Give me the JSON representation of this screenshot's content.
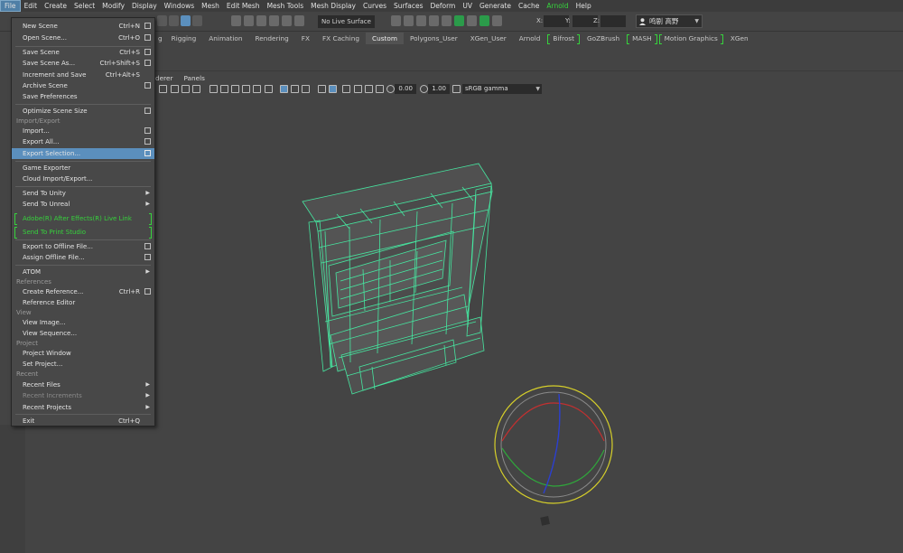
{
  "menubar": {
    "items": [
      "File",
      "Edit",
      "Create",
      "Select",
      "Modify",
      "Display",
      "Windows",
      "Mesh",
      "Edit Mesh",
      "Mesh Tools",
      "Mesh Display",
      "Curves",
      "Surfaces",
      "Deform",
      "UV",
      "Generate",
      "Cache",
      "Arnold",
      "Help"
    ]
  },
  "statusline": {
    "live_surface": "No Live Surface",
    "coord_x_label": "X:",
    "coord_y_label": "Y:",
    "coord_z_label": "Z:",
    "user_name": "鸣剧 高野"
  },
  "shelf": {
    "tabs": [
      "g",
      "Rigging",
      "Animation",
      "Rendering",
      "FX",
      "FX Caching",
      "Custom",
      "Polygons_User",
      "XGen_User",
      "Arnold",
      "Bifrost",
      "GoZBrush",
      "MASH",
      "Motion Graphics",
      "XGen"
    ],
    "selected": "Custom"
  },
  "panel_menu": {
    "items": [
      "derer",
      "Panels"
    ]
  },
  "view_toolbar": {
    "exposure": "0.00",
    "gamma": "1.00",
    "colorspace": "sRGB gamma"
  },
  "file_menu": {
    "items": [
      {
        "label": "New Scene",
        "shortcut": "Ctrl+N",
        "box": true
      },
      {
        "label": "Open Scene...",
        "shortcut": "Ctrl+O",
        "box": true
      },
      {
        "label": "Save Scene",
        "shortcut": "Ctrl+S",
        "box": true
      },
      {
        "label": "Save Scene As...",
        "shortcut": "Ctrl+Shift+S",
        "box": true
      },
      {
        "label": "Increment and Save",
        "shortcut": "Ctrl+Alt+S",
        "box": false
      },
      {
        "label": "Archive Scene",
        "shortcut": "",
        "box": true
      },
      {
        "label": "Save Preferences",
        "shortcut": "",
        "box": false
      },
      {
        "label": "Optimize Scene Size",
        "shortcut": "",
        "box": true
      },
      {
        "section": "Import/Export"
      },
      {
        "label": "Import...",
        "shortcut": "",
        "box": true
      },
      {
        "label": "Export All...",
        "shortcut": "",
        "box": true
      },
      {
        "label": "Export Selection...",
        "shortcut": "",
        "box": true,
        "highlight": true
      },
      {
        "label": "Game Exporter",
        "shortcut": "",
        "box": false
      },
      {
        "label": "Cloud Import/Export...",
        "shortcut": "",
        "box": false
      },
      {
        "label": "Send To Unity",
        "shortcut": "",
        "arrow": true
      },
      {
        "label": "Send To Unreal",
        "shortcut": "",
        "arrow": true
      },
      {
        "label": "Adobe(R) After Effects(R) Live Link",
        "arnold": true
      },
      {
        "label": "Send To Print Studio",
        "arnold": true
      },
      {
        "label": "Export to Offline File...",
        "shortcut": "",
        "box": true
      },
      {
        "label": "Assign Offline File...",
        "shortcut": "",
        "box": true
      },
      {
        "label": "ATOM",
        "shortcut": "",
        "arrow": true
      },
      {
        "section": "References"
      },
      {
        "label": "Create Reference...",
        "shortcut": "Ctrl+R",
        "box": true
      },
      {
        "label": "Reference Editor",
        "shortcut": "",
        "box": false
      },
      {
        "section": "View"
      },
      {
        "label": "View Image...",
        "shortcut": "",
        "box": false
      },
      {
        "label": "View Sequence...",
        "shortcut": "",
        "box": false
      },
      {
        "section": "Project"
      },
      {
        "label": "Project Window",
        "shortcut": "",
        "box": false
      },
      {
        "label": "Set Project...",
        "shortcut": "",
        "box": false
      },
      {
        "section": "Recent"
      },
      {
        "label": "Recent Files",
        "shortcut": "",
        "arrow": true
      },
      {
        "label": "Recent Increments",
        "shortcut": "",
        "arrow": true,
        "disabled": true
      },
      {
        "label": "Recent Projects",
        "shortcut": "",
        "arrow": true
      },
      {
        "label": "Exit",
        "shortcut": "Ctrl+Q",
        "box": false
      }
    ]
  },
  "colors": {
    "menu_highlight": "#5b8fbd",
    "arnold_green": "#36d23c",
    "wireframe": "#46e6a0",
    "background": "#444444"
  }
}
